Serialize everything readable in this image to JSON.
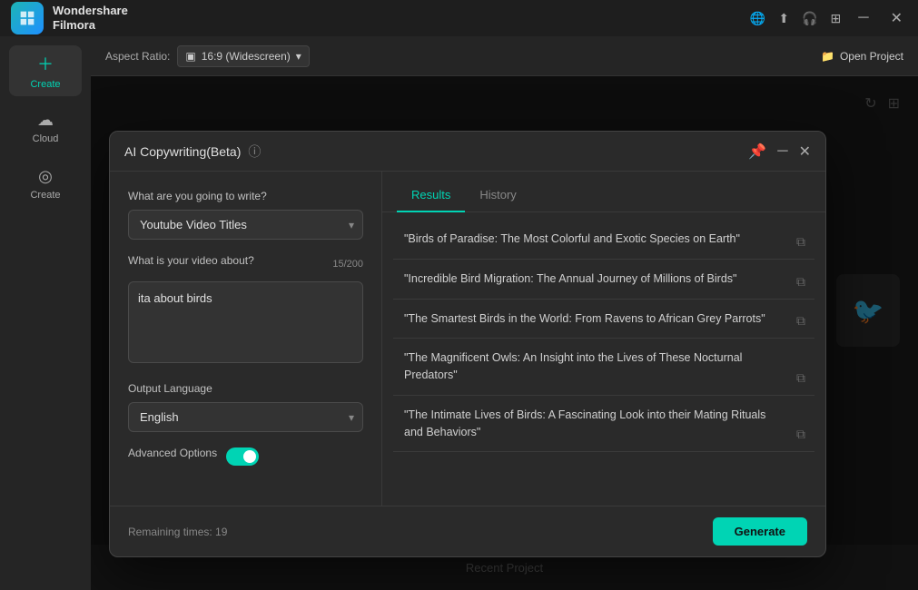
{
  "app": {
    "name_line1": "Wondershare",
    "name_line2": "Filmora"
  },
  "titlebar": {
    "icons": [
      "globe-icon",
      "cloud-icon",
      "headset-icon",
      "grid-icon"
    ],
    "buttons": [
      "minimize-btn",
      "close-btn"
    ]
  },
  "toolbar": {
    "aspect_ratio_label": "Aspect Ratio:",
    "aspect_ratio_value": "16:9 (Widescreen)",
    "open_project_label": "Open Project"
  },
  "sidebar": {
    "items": [
      {
        "label": "Create",
        "icon": "+"
      },
      {
        "label": "Cloud",
        "icon": "☁"
      },
      {
        "label": "Create",
        "icon": "◎"
      }
    ]
  },
  "dialog": {
    "title": "AI Copywriting(Beta)",
    "tabs": [
      {
        "label": "Results",
        "active": true
      },
      {
        "label": "History",
        "active": false
      }
    ],
    "form": {
      "what_label": "What are you going to write?",
      "type_value": "Youtube Video Titles",
      "about_label": "What is your video about?",
      "about_value": "ita about birds",
      "char_count": "15/200",
      "output_lang_label": "Output Language",
      "output_lang_value": "English",
      "advanced_options_label": "Advanced Options",
      "advanced_toggle": true
    },
    "footer": {
      "remaining_label": "Remaining times: 19",
      "generate_label": "Generate"
    },
    "results": [
      {
        "text": "\"Birds of Paradise: The Most Colorful and Exotic Species on Earth\""
      },
      {
        "text": "\"Incredible Bird Migration: The Annual Journey of Millions of Birds\""
      },
      {
        "text": "\"The Smartest Birds in the World: From Ravens to African Grey Parrots\""
      },
      {
        "text": "\"The Magnificent Owls: An Insight into the Lives of These Nocturnal Predators\""
      },
      {
        "text": "\"The Intimate Lives of Birds: A Fascinating Look into their Mating Rituals and Behaviors\""
      }
    ]
  },
  "bg": {
    "recent_project_label": "Recent Project"
  }
}
